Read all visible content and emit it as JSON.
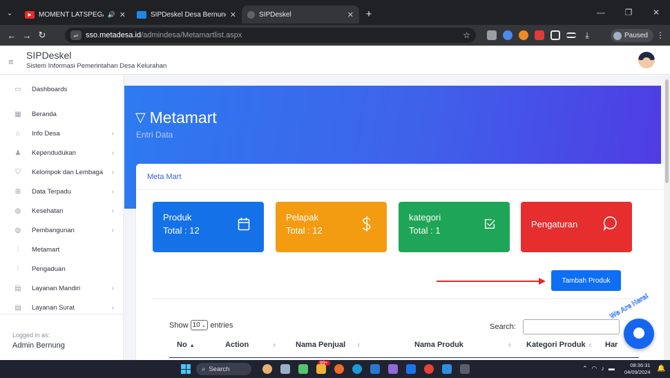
{
  "browser": {
    "tabs": [
      {
        "title": "MOMENT LATSPEGAS SYIL",
        "favicon_color": "#e52d27",
        "active": false
      },
      {
        "title": "SIPDeskel Desa Bernung",
        "favicon_color": "#1e88e5",
        "active": false
      },
      {
        "title": "SIPDeskel",
        "favicon_color": "#9aa0a6",
        "active": true
      }
    ],
    "url_host": "sso.metadesa.id",
    "url_path": "/admindesa/Metamartlist.aspx",
    "profile_status": "Paused"
  },
  "header": {
    "app_title": "SIPDeskel",
    "app_subtitle": "Sistem Informasi Pemerintahan Desa Kelurahan"
  },
  "sidebar": {
    "items": [
      {
        "label": "Dashboards",
        "icon": "monitor-icon",
        "has_children": false
      },
      {
        "label": "Beranda",
        "icon": "grid-icon",
        "has_children": false
      },
      {
        "label": "Info Desa",
        "icon": "bank-icon",
        "has_children": true
      },
      {
        "label": "Kependudukan",
        "icon": "users-icon",
        "has_children": true
      },
      {
        "label": "Kelompok dan Lembaga",
        "icon": "shield-icon",
        "has_children": true
      },
      {
        "label": "Data Terpadu",
        "icon": "apps-icon",
        "has_children": true
      },
      {
        "label": "Kesehatan",
        "icon": "globe-icon",
        "has_children": true
      },
      {
        "label": "Pembangunan",
        "icon": "globe-icon",
        "has_children": true
      },
      {
        "label": "Metamart",
        "icon": "bar-chart-icon",
        "has_children": false
      },
      {
        "label": "Pengaduan",
        "icon": "bar-chart-icon",
        "has_children": false
      },
      {
        "label": "Layanan Mandiri",
        "icon": "table-icon",
        "has_children": true
      },
      {
        "label": "Layanan Surat",
        "icon": "table-icon",
        "has_children": true
      }
    ],
    "logged_in_label": "Logged in as:",
    "logged_in_user": "Admin Bernung"
  },
  "page": {
    "title": "Metamart",
    "subtitle": "Entri Data"
  },
  "card": {
    "title": "Meta Mart",
    "stats": [
      {
        "title": "Produk",
        "total": "Total : 12",
        "icon": "calendar-icon",
        "color": "#1471e8"
      },
      {
        "title": "Pelapak",
        "total": "Total : 12",
        "icon": "dollar-icon",
        "color": "#f39c12"
      },
      {
        "title": "kategori",
        "total": "Total : 1",
        "icon": "check-square-icon",
        "color": "#1fa557"
      },
      {
        "title": "Pengaturan",
        "total": "",
        "icon": "chat-icon",
        "color": "#e62e2e"
      }
    ],
    "add_button": "Tambah Produk"
  },
  "table": {
    "show_label": "Show",
    "page_size": "10",
    "entries_label": "entries",
    "search_label": "Search:",
    "columns": [
      "No",
      "Action",
      "Nama Penjual",
      "Nama Produk",
      "Kategori Produk",
      "Har"
    ]
  },
  "chat_widget": {
    "tagline": "We Are Here!"
  },
  "taskbar": {
    "search_placeholder": "Search",
    "notification_count": "99+",
    "time": "08:36:31",
    "date": "04/09/2024"
  }
}
